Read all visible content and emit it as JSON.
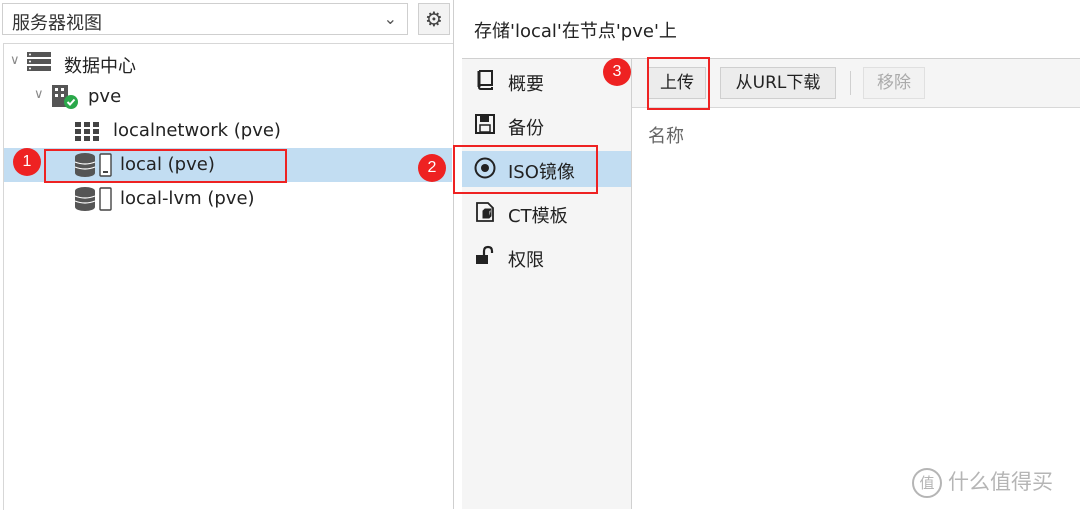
{
  "left_panel": {
    "view_select": {
      "value": "服务器视图",
      "chevron": "⌄"
    },
    "gear_icon": "⚙",
    "tree": [
      {
        "label": "数据中心",
        "icon": "datacenter-icon",
        "twisty": "∨"
      },
      {
        "label": "pve",
        "icon": "node-icon",
        "twisty": "∨"
      },
      {
        "label": "localnetwork (pve)",
        "icon": "network-grid-icon"
      },
      {
        "label": "local (pve)",
        "icon": "storage-icon",
        "selected": true
      },
      {
        "label": "local-lvm (pve)",
        "icon": "storage-icon"
      }
    ]
  },
  "title": "存储'local'在节点'pve'上",
  "nav": [
    {
      "label": "概要",
      "icon": "book-icon"
    },
    {
      "label": "备份",
      "icon": "floppy-icon"
    },
    {
      "label": "ISO镜像",
      "icon": "disc-icon",
      "selected": true
    },
    {
      "label": "CT模板",
      "icon": "file-cube-icon"
    },
    {
      "label": "权限",
      "icon": "unlock-icon"
    }
  ],
  "toolbar": {
    "upload": "上传",
    "download_url": "从URL下载",
    "remove": "移除"
  },
  "grid": {
    "column_name": "名称"
  },
  "annotations": [
    "1",
    "2",
    "3"
  ],
  "watermark": {
    "symbol": "值",
    "text": "什么值得买"
  },
  "colors": {
    "selection": "#c2ddf2",
    "annotation": "#ee2222"
  }
}
